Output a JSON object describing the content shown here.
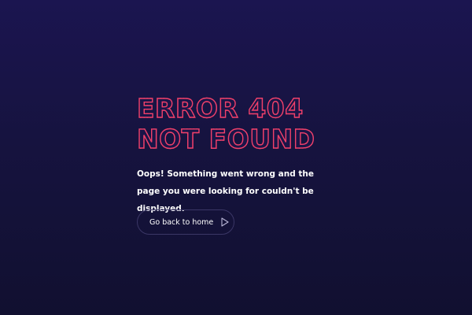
{
  "error": {
    "title_line1": "ERROR 404",
    "title_line2": "NOT FOUND",
    "message": "Oops! Something went wrong and the page you were looking for couldn't be displayed."
  },
  "actions": {
    "home_button_label": "Go back to home",
    "home_button_icon": "play-arrow-icon"
  },
  "colors": {
    "accent": "#f0406a",
    "background_top": "#1b1550",
    "background_bottom": "#111030",
    "text": "#ffffff"
  }
}
